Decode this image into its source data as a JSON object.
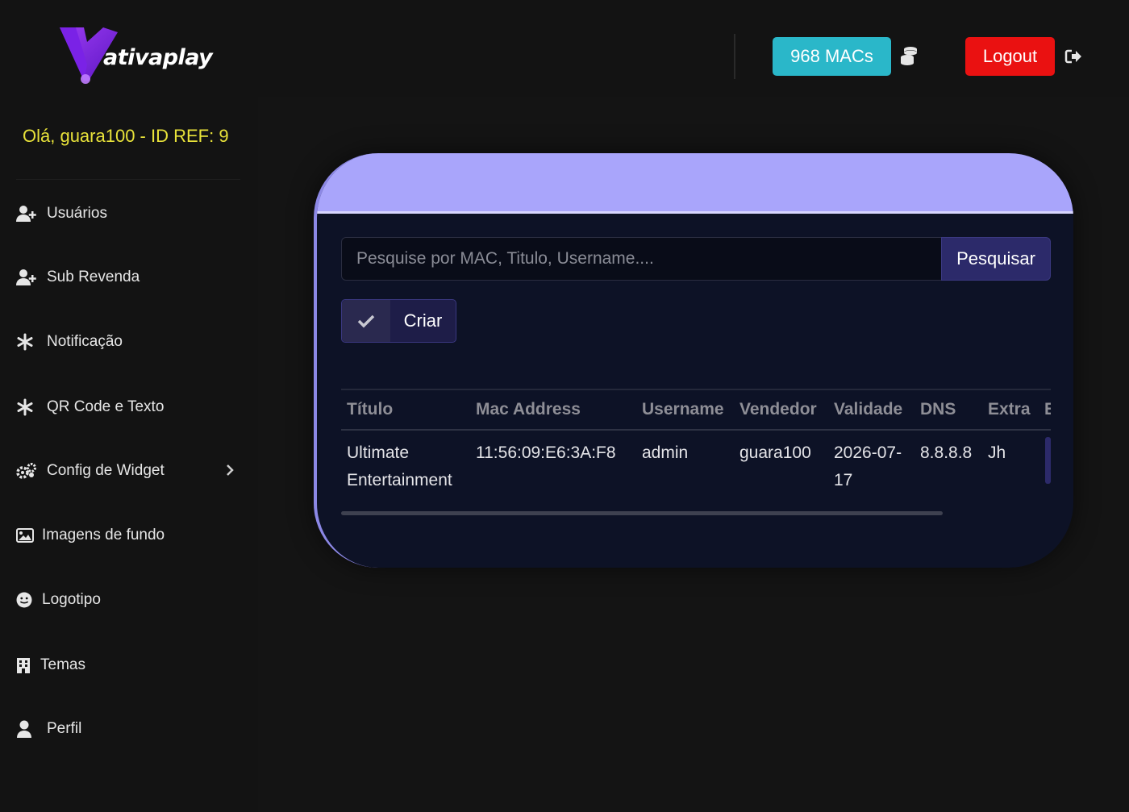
{
  "brand": {
    "logo_text": "ativaplay",
    "accent": "#8a2be2"
  },
  "user": {
    "greeting": "Olá, guara100 - ID REF: 9"
  },
  "sidebar": {
    "items": [
      {
        "label": "Usuários",
        "icon": "user-plus-icon"
      },
      {
        "label": "Sub Revenda",
        "icon": "user-plus-icon"
      },
      {
        "label": "Notificação",
        "icon": "asterisk-icon"
      },
      {
        "label": "QR Code e Texto",
        "icon": "asterisk-icon"
      },
      {
        "label": "Config de Widget",
        "icon": "gears-icon",
        "has_submenu": true
      },
      {
        "label": "Imagens de fundo",
        "icon": "image-icon"
      },
      {
        "label": "Logotipo",
        "icon": "smile-icon"
      },
      {
        "label": "Temas",
        "icon": "building-icon"
      },
      {
        "label": "Perfil",
        "icon": "user-icon"
      }
    ]
  },
  "header": {
    "macs_label": "968 MACs",
    "macs_color": "#2ab7c9",
    "logout_label": "Logout",
    "logout_color": "#ea1111"
  },
  "main": {
    "search": {
      "placeholder": "Pesquise por MAC, Titulo, Username....",
      "value": "",
      "button_label": "Pesquisar"
    },
    "create_label": "Criar",
    "table": {
      "columns": [
        "Título",
        "Mac Address",
        "Username",
        "Vendedor",
        "Validade",
        "DNS",
        "Extra",
        "E"
      ],
      "rows": [
        {
          "titulo": "Ultimate Entertainment",
          "mac": "11:56:09:E6:3A:F8",
          "username": "admin",
          "vendedor": "guara100",
          "validade": "2026-07-17",
          "dns": "8.8.8.8",
          "extra": "Jh"
        }
      ]
    }
  }
}
